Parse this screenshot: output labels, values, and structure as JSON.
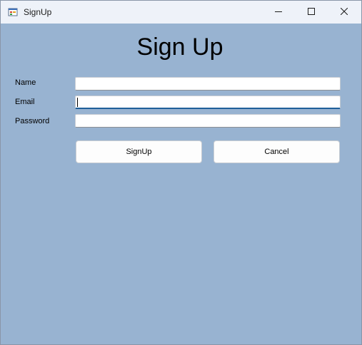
{
  "window": {
    "title": "SignUp"
  },
  "form": {
    "heading": "Sign Up",
    "name_label": "Name",
    "name_value": "",
    "email_label": "Email",
    "email_value": "",
    "password_label": "Password",
    "password_value": ""
  },
  "buttons": {
    "signup_label": "SignUp",
    "cancel_label": "Cancel"
  },
  "icons": {
    "app": "app-form-icon",
    "minimize": "minimize-icon",
    "maximize": "maximize-icon",
    "close": "close-icon"
  },
  "colors": {
    "client_background": "#98b3d1",
    "titlebar_background": "#eef2f9",
    "focus_underline": "#1f5f9a"
  }
}
